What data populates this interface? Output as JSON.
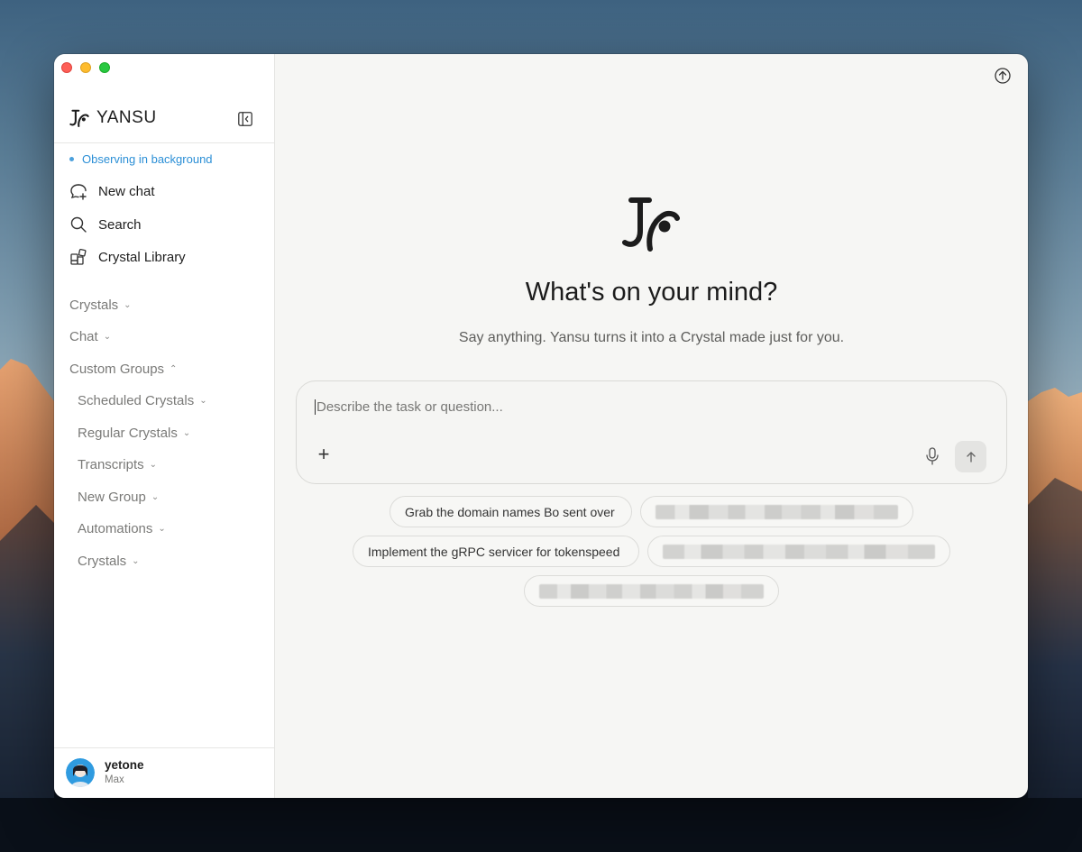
{
  "app": {
    "brand_name": "YANSU",
    "status": "Observing in background"
  },
  "sidebar": {
    "nav": [
      {
        "label": "New chat",
        "icon": "new-chat-icon"
      },
      {
        "label": "Search",
        "icon": "search-icon"
      },
      {
        "label": "Crystal Library",
        "icon": "library-icon"
      }
    ],
    "groups": {
      "crystals": "Crystals",
      "chat": "Chat",
      "custom_groups": "Custom Groups",
      "sub": [
        "Scheduled Crystals",
        "Regular Crystals",
        "Transcripts",
        "New Group",
        "Automations",
        "Crystals"
      ]
    },
    "user": {
      "name": "yetone",
      "plan": "Max"
    }
  },
  "main": {
    "headline": "What's on your mind?",
    "subline": "Say anything. Yansu turns it into a Crystal made just for you.",
    "composer": {
      "placeholder": "Describe the task or question..."
    },
    "suggestions": [
      "Grab the domain names Bo sent over",
      "Implement the gRPC servicer for tokenspeed"
    ]
  },
  "colors": {
    "accent": "#2b8fd6",
    "window_bg": "#f6f6f4",
    "sidebar_bg": "#ffffff"
  }
}
